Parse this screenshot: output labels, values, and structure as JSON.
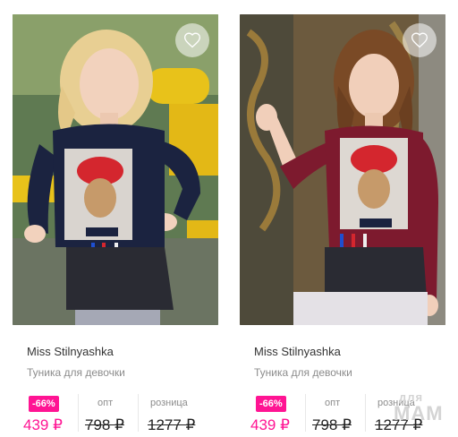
{
  "products": [
    {
      "brand": "Miss Stilnyashka",
      "type": "Туника для девочки",
      "discount": "-66%",
      "price_now": "439 ₽",
      "opt_label": "опт",
      "opt_price": "798 ₽",
      "retail_label": "розница",
      "retail_price": "1277 ₽",
      "shirt_color": "#1b2340",
      "photo_icon": "favorite-heart-icon"
    },
    {
      "brand": "Miss Stilnyashka",
      "type": "Туника для девочки",
      "discount": "-66%",
      "price_now": "439 ₽",
      "opt_label": "опт",
      "opt_price": "798 ₽",
      "retail_label": "розница",
      "retail_price": "1277 ₽",
      "shirt_color": "#7d1a2e",
      "photo_icon": "favorite-heart-icon"
    }
  ],
  "watermark": {
    "top": "для",
    "bottom": "МАМ"
  },
  "colors": {
    "accent": "#ff1493",
    "muted": "#8c8c8c"
  }
}
